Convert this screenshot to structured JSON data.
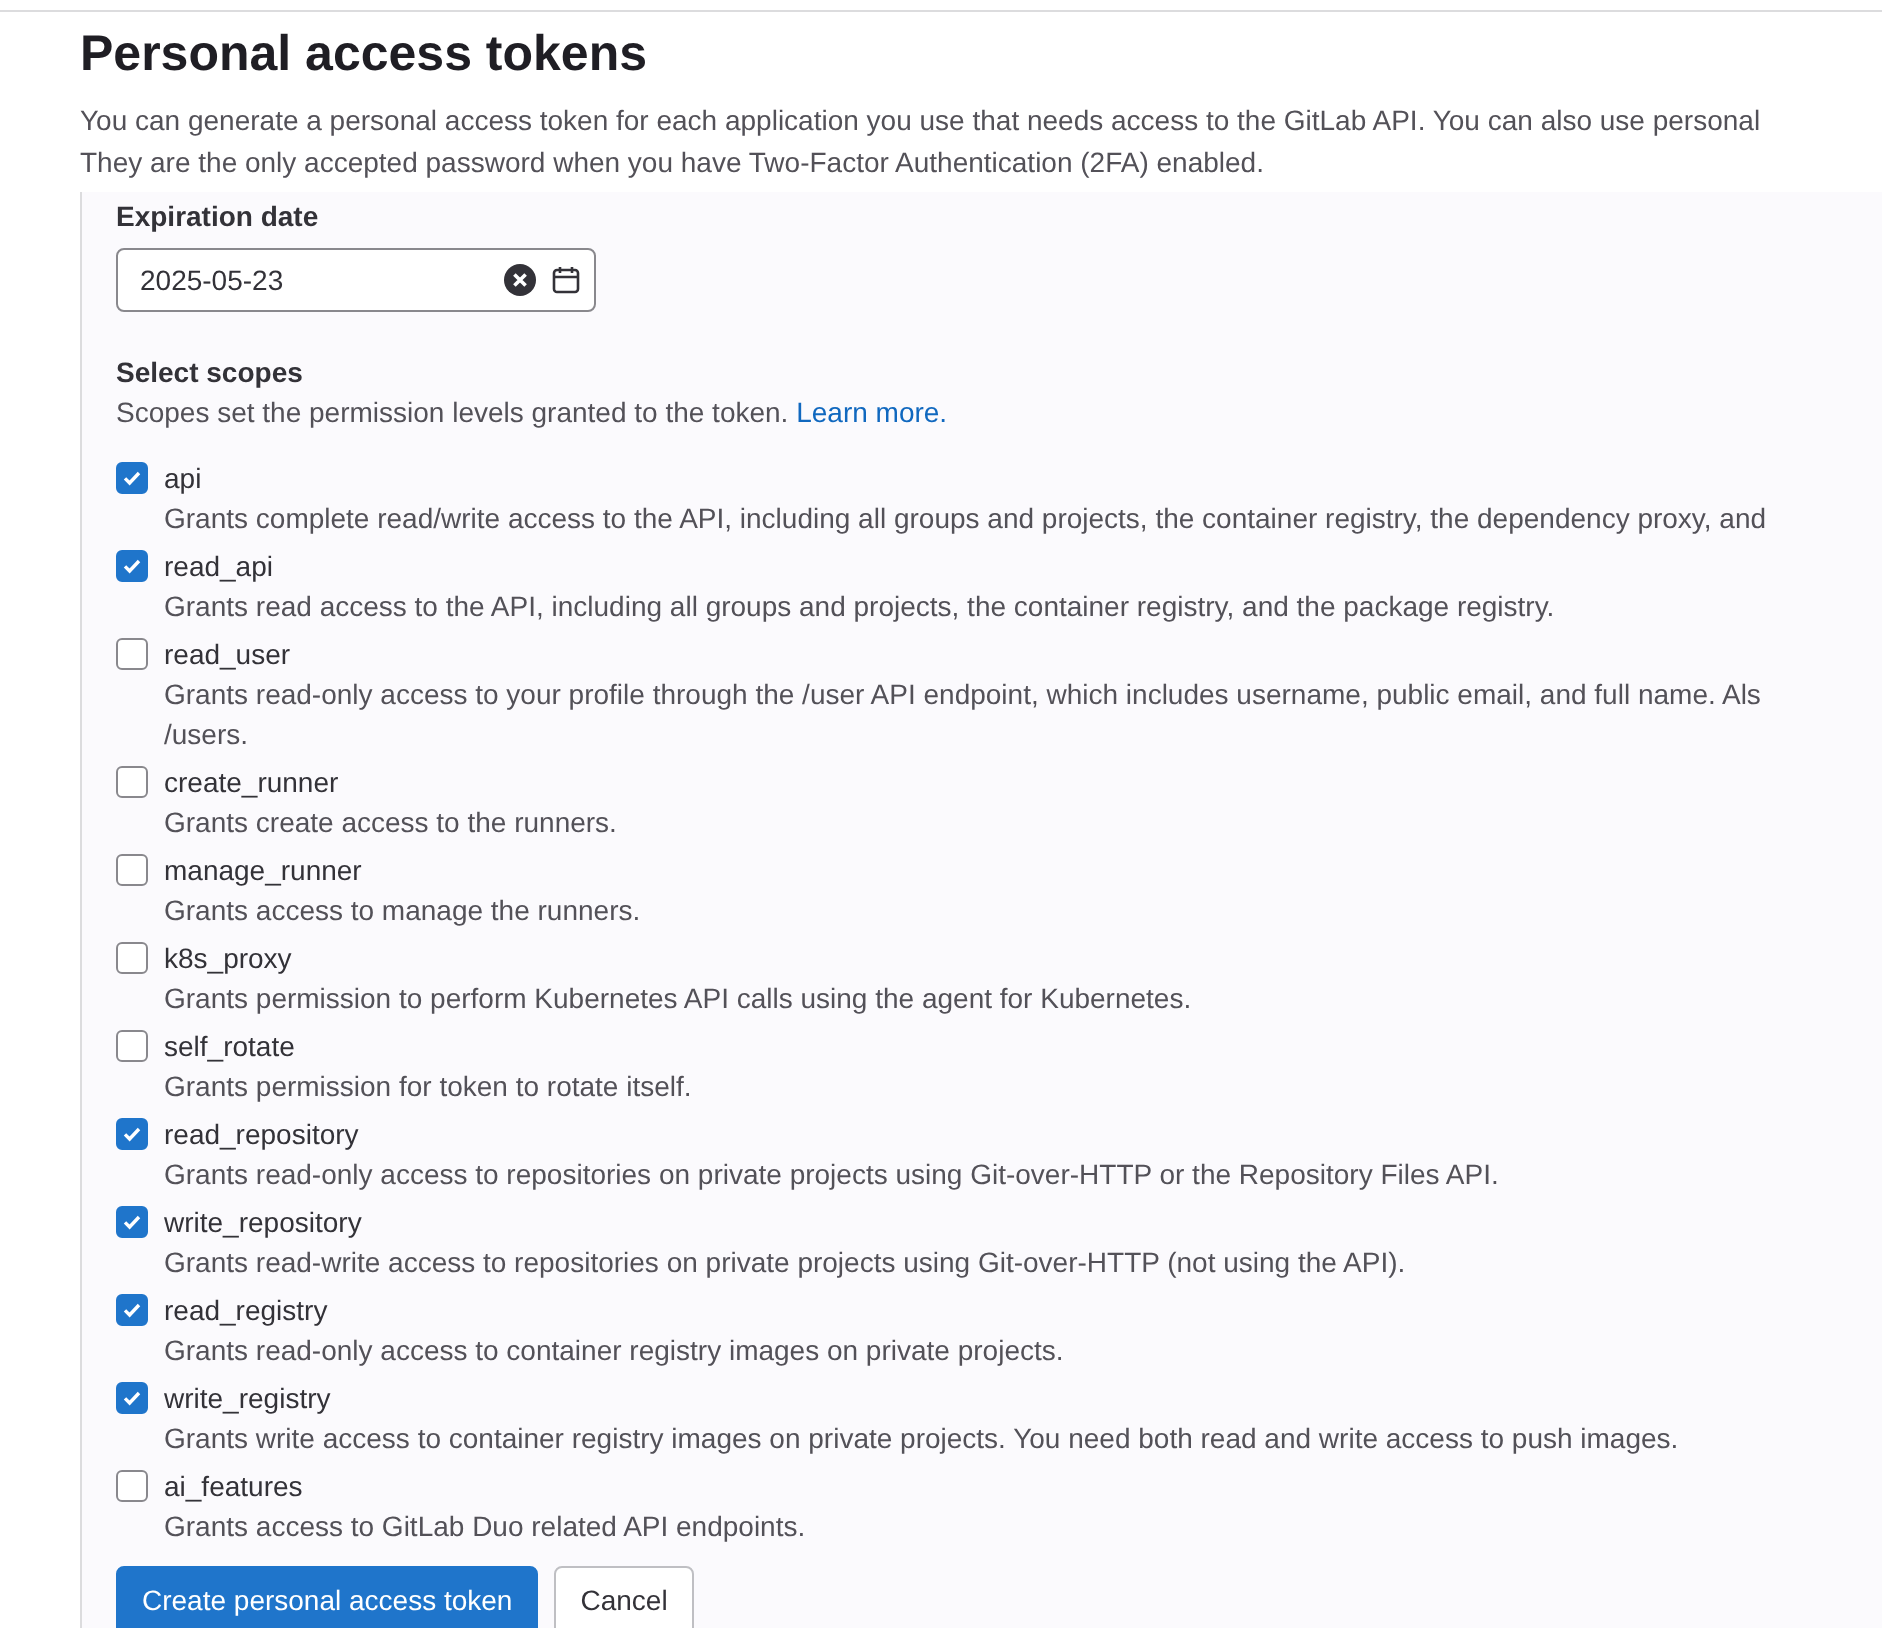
{
  "title": "Personal access tokens",
  "description_lines": [
    "You can generate a personal access token for each application you use that needs access to the GitLab API. You can also use personal",
    "They are the only accepted password when you have Two-Factor Authentication (2FA) enabled."
  ],
  "expiration": {
    "label": "Expiration date",
    "value": "2025-05-23"
  },
  "scopes_section": {
    "label": "Select scopes",
    "help": "Scopes set the permission levels granted to the token.",
    "link": "Learn more."
  },
  "scopes": [
    {
      "name": "api",
      "checked": true,
      "description": [
        "Grants complete read/write access to the API, including all groups and projects, the container registry, the dependency proxy, and"
      ]
    },
    {
      "name": "read_api",
      "checked": true,
      "description": [
        "Grants read access to the API, including all groups and projects, the container registry, and the package registry."
      ]
    },
    {
      "name": "read_user",
      "checked": false,
      "description": [
        "Grants read-only access to your profile through the /user API endpoint, which includes username, public email, and full name. Als",
        "/users."
      ]
    },
    {
      "name": "create_runner",
      "checked": false,
      "description": [
        "Grants create access to the runners."
      ]
    },
    {
      "name": "manage_runner",
      "checked": false,
      "description": [
        "Grants access to manage the runners."
      ]
    },
    {
      "name": "k8s_proxy",
      "checked": false,
      "description": [
        "Grants permission to perform Kubernetes API calls using the agent for Kubernetes."
      ]
    },
    {
      "name": "self_rotate",
      "checked": false,
      "description": [
        "Grants permission for token to rotate itself."
      ]
    },
    {
      "name": "read_repository",
      "checked": true,
      "description": [
        "Grants read-only access to repositories on private projects using Git-over-HTTP or the Repository Files API."
      ]
    },
    {
      "name": "write_repository",
      "checked": true,
      "description": [
        "Grants read-write access to repositories on private projects using Git-over-HTTP (not using the API)."
      ]
    },
    {
      "name": "read_registry",
      "checked": true,
      "description": [
        "Grants read-only access to container registry images on private projects."
      ]
    },
    {
      "name": "write_registry",
      "checked": true,
      "description": [
        "Grants write access to container registry images on private projects. You need both read and write access to push images."
      ]
    },
    {
      "name": "ai_features",
      "checked": false,
      "description": [
        "Grants access to GitLab Duo related API endpoints."
      ]
    }
  ],
  "buttons": [
    {
      "label": "Create personal access token",
      "kind": "primary"
    },
    {
      "label": "Cancel",
      "kind": "secondary"
    }
  ]
}
